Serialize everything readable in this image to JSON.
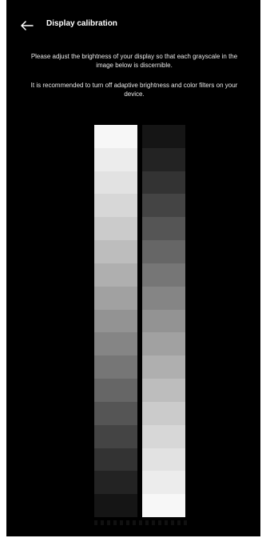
{
  "header": {
    "title": "Display calibration",
    "back_icon": "arrow-left-icon"
  },
  "description": {
    "line1": "Please adjust the brightness of your display so that each grayscale in the image below is discernible.",
    "line2": "It is recommended to turn off adaptive brightness and color filters on your device."
  },
  "calibration": {
    "steps": 17,
    "left_strip": [
      "#f7f7f7",
      "#ececec",
      "#e2e2e2",
      "#d7d7d7",
      "#cbcbcb",
      "#bdbdbd",
      "#afafaf",
      "#a1a1a1",
      "#939393",
      "#858585",
      "#767676",
      "#666666",
      "#555555",
      "#444444",
      "#333333",
      "#232323",
      "#151515"
    ],
    "right_strip": [
      "#151515",
      "#232323",
      "#333333",
      "#444444",
      "#555555",
      "#666666",
      "#767676",
      "#858585",
      "#939393",
      "#a1a1a1",
      "#afafaf",
      "#bdbdbd",
      "#cbcbcb",
      "#d7d7d7",
      "#e2e2e2",
      "#ececec",
      "#f7f7f7"
    ]
  }
}
